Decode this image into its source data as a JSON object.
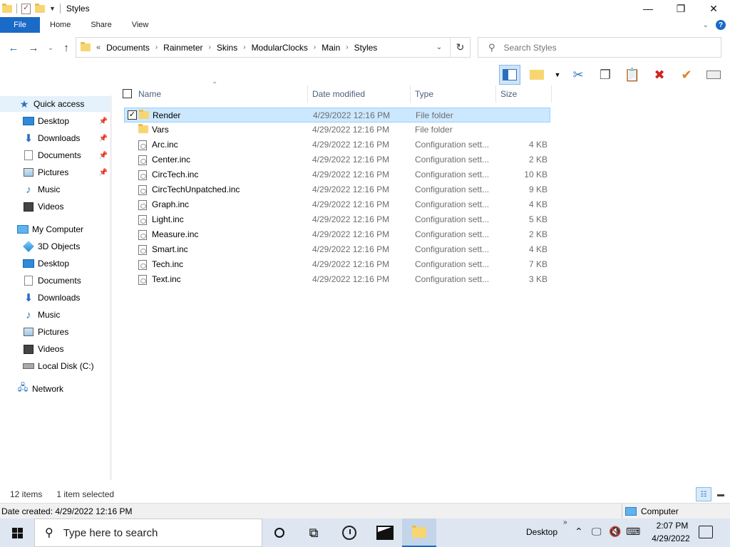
{
  "window": {
    "title": "Styles"
  },
  "ribbon": {
    "tabs": [
      "File",
      "Home",
      "Share",
      "View"
    ],
    "help": "?"
  },
  "nav": {
    "breadcrumbs": [
      "Documents",
      "Rainmeter",
      "Skins",
      "ModularClocks",
      "Main",
      "Styles"
    ],
    "overflow": "«",
    "search_placeholder": "Search Styles"
  },
  "navpane": {
    "quick_access": "Quick access",
    "quick_items": [
      {
        "label": "Desktop",
        "icon": "desktop-icon",
        "pinned": true
      },
      {
        "label": "Downloads",
        "icon": "downloads-icon",
        "pinned": true
      },
      {
        "label": "Documents",
        "icon": "documents-icon",
        "pinned": true
      },
      {
        "label": "Pictures",
        "icon": "pictures-icon",
        "pinned": true
      },
      {
        "label": "Music",
        "icon": "music-icon",
        "pinned": false
      },
      {
        "label": "Videos",
        "icon": "videos-icon",
        "pinned": false
      }
    ],
    "computer": "My Computer",
    "computer_items": [
      {
        "label": "3D Objects",
        "icon": "3d-objects-icon"
      },
      {
        "label": "Desktop",
        "icon": "desktop-icon"
      },
      {
        "label": "Documents",
        "icon": "documents-icon"
      },
      {
        "label": "Downloads",
        "icon": "downloads-icon"
      },
      {
        "label": "Music",
        "icon": "music-icon"
      },
      {
        "label": "Pictures",
        "icon": "pictures-icon"
      },
      {
        "label": "Videos",
        "icon": "videos-icon"
      },
      {
        "label": "Local Disk (C:)",
        "icon": "disk-icon"
      }
    ],
    "network": "Network"
  },
  "columns": {
    "name": "Name",
    "date": "Date modified",
    "type": "Type",
    "size": "Size"
  },
  "files": [
    {
      "name": "Render",
      "date": "4/29/2022 12:16 PM",
      "type": "File folder",
      "size": "",
      "kind": "folder",
      "selected": true
    },
    {
      "name": "Vars",
      "date": "4/29/2022 12:16 PM",
      "type": "File folder",
      "size": "",
      "kind": "folder",
      "selected": false
    },
    {
      "name": "Arc.inc",
      "date": "4/29/2022 12:16 PM",
      "type": "Configuration sett...",
      "size": "4 KB",
      "kind": "file",
      "selected": false
    },
    {
      "name": "Center.inc",
      "date": "4/29/2022 12:16 PM",
      "type": "Configuration sett...",
      "size": "2 KB",
      "kind": "file",
      "selected": false
    },
    {
      "name": "CircTech.inc",
      "date": "4/29/2022 12:16 PM",
      "type": "Configuration sett...",
      "size": "10 KB",
      "kind": "file",
      "selected": false
    },
    {
      "name": "CircTechUnpatched.inc",
      "date": "4/29/2022 12:16 PM",
      "type": "Configuration sett...",
      "size": "9 KB",
      "kind": "file",
      "selected": false
    },
    {
      "name": "Graph.inc",
      "date": "4/29/2022 12:16 PM",
      "type": "Configuration sett...",
      "size": "4 KB",
      "kind": "file",
      "selected": false
    },
    {
      "name": "Light.inc",
      "date": "4/29/2022 12:16 PM",
      "type": "Configuration sett...",
      "size": "5 KB",
      "kind": "file",
      "selected": false
    },
    {
      "name": "Measure.inc",
      "date": "4/29/2022 12:16 PM",
      "type": "Configuration sett...",
      "size": "2 KB",
      "kind": "file",
      "selected": false
    },
    {
      "name": "Smart.inc",
      "date": "4/29/2022 12:16 PM",
      "type": "Configuration sett...",
      "size": "4 KB",
      "kind": "file",
      "selected": false
    },
    {
      "name": "Tech.inc",
      "date": "4/29/2022 12:16 PM",
      "type": "Configuration sett...",
      "size": "7 KB",
      "kind": "file",
      "selected": false
    },
    {
      "name": "Text.inc",
      "date": "4/29/2022 12:16 PM",
      "type": "Configuration sett...",
      "size": "3 KB",
      "kind": "file",
      "selected": false
    }
  ],
  "status": {
    "count": "12 items",
    "selection": "1 item selected"
  },
  "details": {
    "date_created": "Date created: 4/29/2022 12:16 PM",
    "location": "Computer"
  },
  "taskbar": {
    "search_text": "Type here to search",
    "desktop_label": "Desktop",
    "time": "2:07 PM",
    "date": "4/29/2022"
  },
  "colors": {
    "accent": "#1a6ac8",
    "selection": "#cce8ff",
    "taskbar": "#dde6f1"
  }
}
